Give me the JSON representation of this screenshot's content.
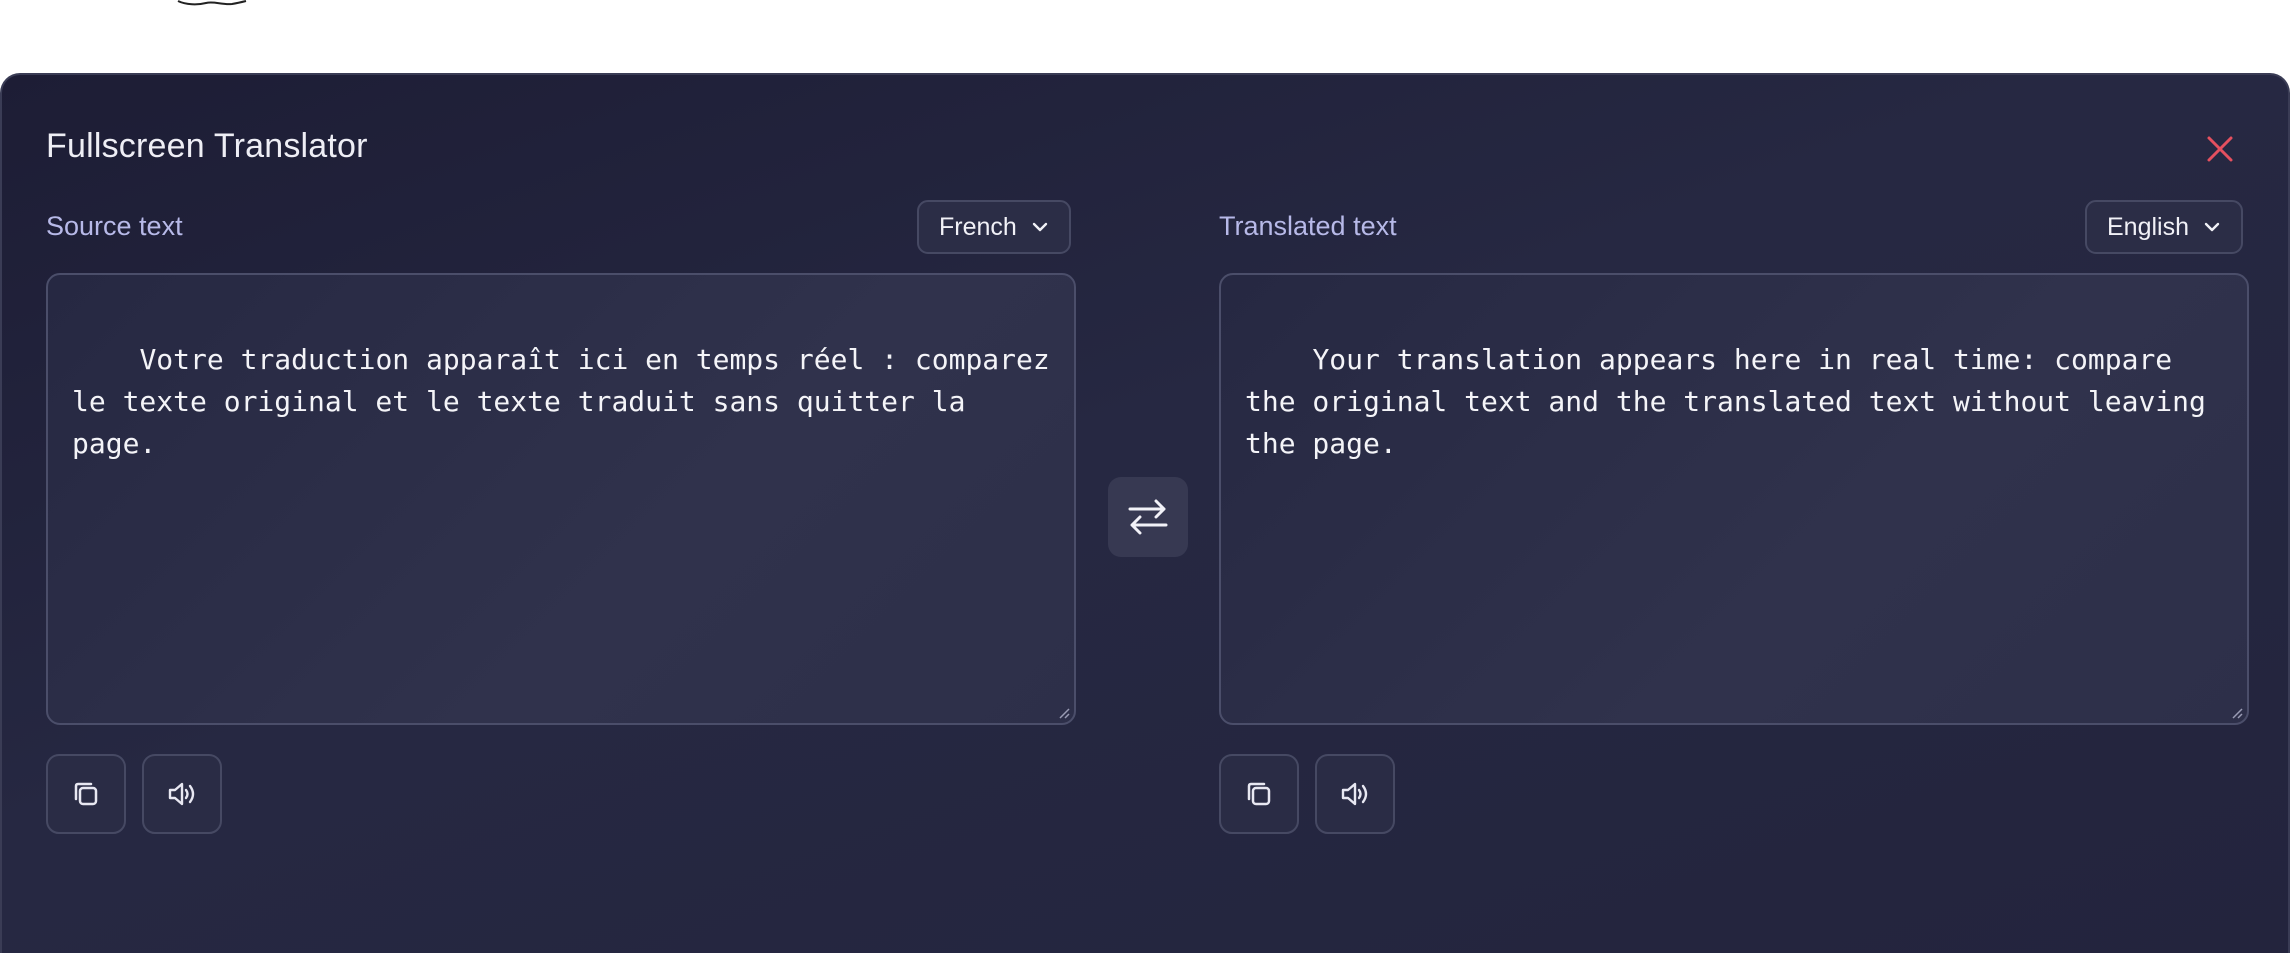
{
  "modal": {
    "title": "Fullscreen Translator"
  },
  "source": {
    "label": "Source text",
    "language": "French",
    "text": "Votre traduction apparaît ici en temps réel : comparez le texte original et le texte traduit sans quitter la page."
  },
  "target": {
    "label": "Translated text",
    "language": "English",
    "text": "Your translation appears here in real time: compare the original text and the translated text without leaving the page."
  },
  "icons": {
    "close": "close-icon",
    "swap": "swap-arrows-icon",
    "copy": "copy-icon",
    "speak": "speaker-icon",
    "dropdown": "chevron-down-icon"
  },
  "colors": {
    "background": "#23243d",
    "close_accent": "#e5505f",
    "label_text": "#b7b9e8"
  }
}
